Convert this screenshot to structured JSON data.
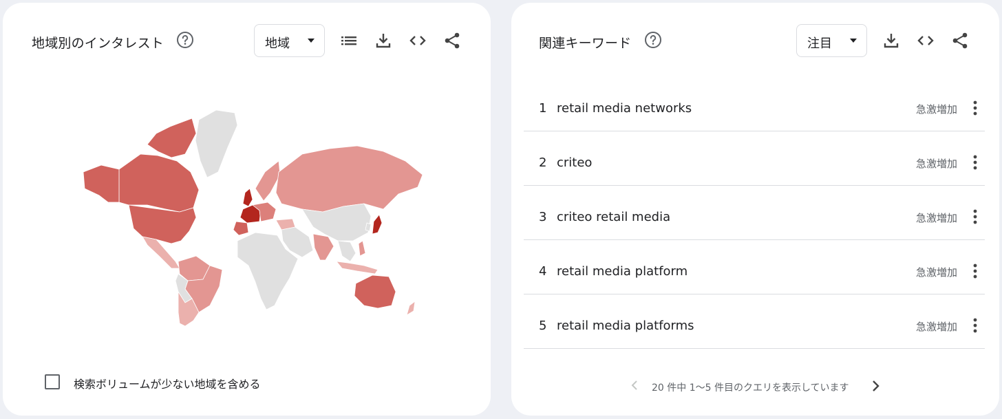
{
  "interest_by_region": {
    "title": "地域別のインタレスト",
    "dropdown_value": "地域",
    "icons": [
      "help-icon",
      "list-icon",
      "download-icon",
      "embed-icon",
      "share-icon"
    ],
    "checkbox_label": "検索ボリュームが少ない地域を含める",
    "checkbox_checked": false,
    "map_colors": {
      "highest": "#b3261e",
      "high": "#d0625c",
      "medium": "#dc807b",
      "low": "#e39692",
      "lower": "#ebb1ad",
      "none": "#e0e0e0"
    }
  },
  "related_queries": {
    "title": "関連キーワード",
    "dropdown_value": "注目",
    "icons": [
      "help-icon",
      "download-icon",
      "embed-icon",
      "share-icon"
    ],
    "items": [
      {
        "rank": "1",
        "query": "retail media networks",
        "status": "急激増加"
      },
      {
        "rank": "2",
        "query": "criteo",
        "status": "急激増加"
      },
      {
        "rank": "3",
        "query": "criteo retail media",
        "status": "急激増加"
      },
      {
        "rank": "4",
        "query": "retail media platform",
        "status": "急激増加"
      },
      {
        "rank": "5",
        "query": "retail media platforms",
        "status": "急激増加"
      }
    ],
    "pagination_text": "20 件中 1～5 件目のクエリを表示しています"
  }
}
